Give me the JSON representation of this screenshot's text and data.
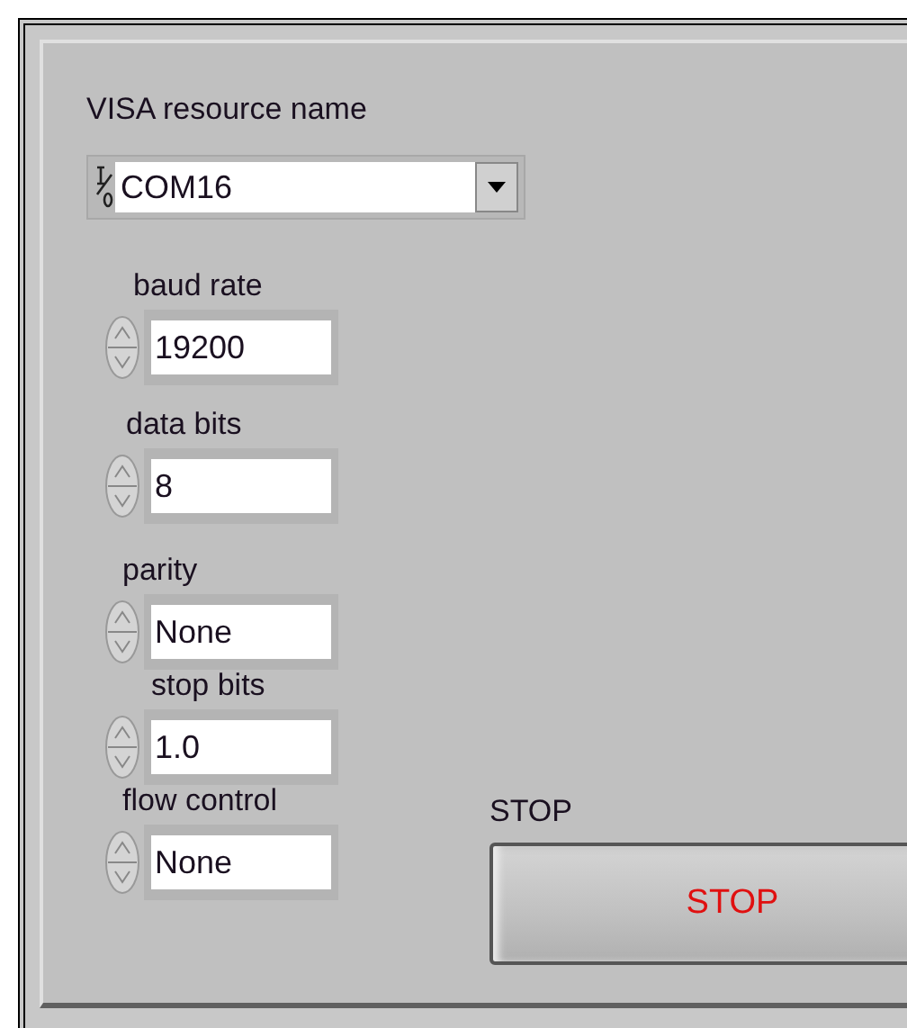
{
  "resource": {
    "label": "VISA resource name",
    "value": "COM16"
  },
  "fields": [
    {
      "label": "baud rate",
      "value": "19200"
    },
    {
      "label": "data bits",
      "value": "8"
    },
    {
      "label": "parity",
      "value": "None"
    },
    {
      "label": "stop bits",
      "value": "1.0"
    },
    {
      "label": "flow control",
      "value": "None"
    }
  ],
  "stop": {
    "label": "STOP",
    "button": "STOP"
  }
}
